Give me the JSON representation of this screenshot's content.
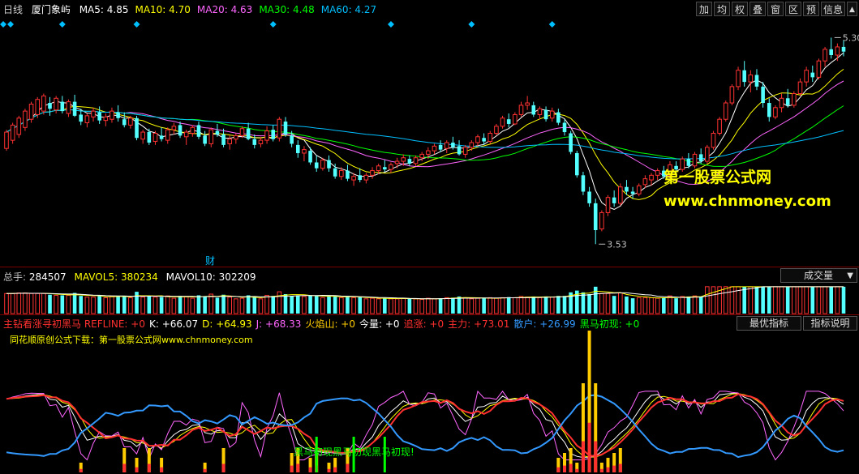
{
  "header": {
    "period": "日线",
    "stock": "厦门象屿",
    "ma": [
      {
        "label": "MA5:",
        "value": "4.85",
        "color": "#ffffff"
      },
      {
        "label": "MA10:",
        "value": "4.70",
        "color": "#ffff00"
      },
      {
        "label": "MA20:",
        "value": "4.63",
        "color": "#ff66ff"
      },
      {
        "label": "MA30:",
        "value": "4.48",
        "color": "#00ff00"
      },
      {
        "label": "MA60:",
        "value": "4.27",
        "color": "#00bfff"
      }
    ]
  },
  "toolbar": [
    "加",
    "均",
    "权",
    "叠",
    "窗",
    "区",
    "预",
    "信息"
  ],
  "toolbar_arrow": "▲",
  "price": {
    "high_label": "5.30",
    "low_label": "3.53",
    "marker": "财",
    "watermark1": "第一股票公式网",
    "watermark2": "www.chnmoney.com"
  },
  "volume": {
    "label": "总手:",
    "value": "284507",
    "mavol5_label": "MAVOL5:",
    "mavol5": "380234",
    "mavol10_label": "MAVOL10:",
    "mavol10": "302209",
    "dropdown": "成交量"
  },
  "indicator": {
    "items": [
      {
        "label": "主钻看涨寻初黑马 REFLINE:",
        "value": "+0",
        "color": "#ff3030"
      },
      {
        "label": "K:",
        "value": "+66.07",
        "color": "#ffffff"
      },
      {
        "label": "D:",
        "value": "+64.93",
        "color": "#ffff00"
      },
      {
        "label": "J:",
        "value": "+68.33",
        "color": "#ff66ff"
      },
      {
        "label": "火焰山:",
        "value": "+0",
        "color": "#ffcc00"
      },
      {
        "label": "今量:",
        "value": "+0",
        "color": "#ffffff"
      },
      {
        "label": "追涨:",
        "value": "+0",
        "color": "#ff3030"
      },
      {
        "label": "主力:",
        "value": "+73.01",
        "color": "#ff3030"
      },
      {
        "label": "散户:",
        "value": "+26.99",
        "color": "#3399ff"
      },
      {
        "label": "黑马初现:",
        "value": "+0",
        "color": "#00ff00"
      }
    ],
    "btn_best": "最优指标",
    "btn_desc": "指标说明",
    "note": "同花顺原创公式下载：第一股票公式网www.chnmoney.com",
    "signal_text": "黑马初现黑马初现黑马初现!"
  },
  "chart_data": {
    "type": "candlestick",
    "ylim": [
      3.4,
      5.4
    ],
    "ohlc": [
      [
        4.35,
        4.51,
        4.33,
        4.49
      ],
      [
        4.42,
        4.57,
        4.39,
        4.55
      ],
      [
        4.47,
        4.63,
        4.44,
        4.61
      ],
      [
        4.53,
        4.69,
        4.5,
        4.67
      ],
      [
        4.6,
        4.75,
        4.57,
        4.73
      ],
      [
        4.64,
        4.79,
        4.61,
        4.77
      ],
      [
        4.67,
        4.82,
        4.64,
        4.8
      ],
      [
        4.74,
        4.79,
        4.63,
        4.69
      ],
      [
        4.68,
        4.8,
        4.65,
        4.78
      ],
      [
        4.75,
        4.8,
        4.65,
        4.67
      ],
      [
        4.65,
        4.77,
        4.62,
        4.75
      ],
      [
        4.75,
        4.81,
        4.62,
        4.63
      ],
      [
        4.64,
        4.69,
        4.55,
        4.58
      ],
      [
        4.57,
        4.65,
        4.53,
        4.63
      ],
      [
        4.62,
        4.7,
        4.58,
        4.67
      ],
      [
        4.66,
        4.71,
        4.56,
        4.59
      ],
      [
        4.59,
        4.65,
        4.54,
        4.62
      ],
      [
        4.6,
        4.7,
        4.57,
        4.67
      ],
      [
        4.66,
        4.72,
        4.58,
        4.61
      ],
      [
        4.6,
        4.66,
        4.53,
        4.55
      ],
      [
        4.55,
        4.63,
        4.52,
        4.61
      ],
      [
        4.61,
        4.63,
        4.42,
        4.44
      ],
      [
        4.43,
        4.51,
        4.39,
        4.49
      ],
      [
        4.49,
        4.52,
        4.38,
        4.4
      ],
      [
        4.41,
        4.5,
        4.38,
        4.48
      ],
      [
        4.46,
        4.53,
        4.41,
        4.43
      ],
      [
        4.42,
        4.53,
        4.39,
        4.51
      ],
      [
        4.51,
        4.57,
        4.47,
        4.54
      ],
      [
        4.55,
        4.58,
        4.44,
        4.46
      ],
      [
        4.45,
        4.51,
        4.38,
        4.49
      ],
      [
        4.48,
        4.55,
        4.45,
        4.53
      ],
      [
        4.55,
        4.58,
        4.43,
        4.45
      ],
      [
        4.46,
        4.5,
        4.37,
        4.39
      ],
      [
        4.39,
        4.53,
        4.36,
        4.51
      ],
      [
        4.5,
        4.56,
        4.45,
        4.47
      ],
      [
        4.47,
        4.52,
        4.36,
        4.38
      ],
      [
        4.39,
        4.46,
        4.34,
        4.43
      ],
      [
        4.43,
        4.48,
        4.39,
        4.46
      ],
      [
        4.46,
        4.54,
        4.44,
        4.52
      ],
      [
        4.52,
        4.57,
        4.42,
        4.43
      ],
      [
        4.43,
        4.47,
        4.35,
        4.38
      ],
      [
        4.39,
        4.45,
        4.36,
        4.42
      ],
      [
        4.42,
        4.54,
        4.39,
        4.5
      ],
      [
        4.51,
        4.55,
        4.41,
        4.43
      ],
      [
        4.44,
        4.62,
        4.41,
        4.6
      ],
      [
        4.58,
        4.62,
        4.45,
        4.47
      ],
      [
        4.46,
        4.5,
        4.36,
        4.39
      ],
      [
        4.38,
        4.42,
        4.27,
        4.31
      ],
      [
        4.31,
        4.37,
        4.24,
        4.34
      ],
      [
        4.33,
        4.36,
        4.21,
        4.23
      ],
      [
        4.23,
        4.29,
        4.15,
        4.18
      ],
      [
        4.18,
        4.27,
        4.16,
        4.25
      ],
      [
        4.25,
        4.29,
        4.15,
        4.18
      ],
      [
        4.18,
        4.22,
        4.09,
        4.11
      ],
      [
        4.11,
        4.19,
        4.08,
        4.16
      ],
      [
        4.16,
        4.21,
        4.07,
        4.09
      ],
      [
        4.08,
        4.14,
        4.03,
        4.11
      ],
      [
        4.12,
        4.18,
        4.06,
        4.08
      ],
      [
        4.08,
        4.14,
        4.05,
        4.12
      ],
      [
        4.12,
        4.19,
        4.09,
        4.16
      ],
      [
        4.16,
        4.22,
        4.13,
        4.2
      ],
      [
        4.19,
        4.25,
        4.15,
        4.17
      ],
      [
        4.17,
        4.23,
        4.14,
        4.21
      ],
      [
        4.22,
        4.27,
        4.18,
        4.24
      ],
      [
        4.24,
        4.3,
        4.2,
        4.27
      ],
      [
        4.26,
        4.29,
        4.2,
        4.22
      ],
      [
        4.22,
        4.29,
        4.2,
        4.27
      ],
      [
        4.27,
        4.32,
        4.24,
        4.3
      ],
      [
        4.3,
        4.36,
        4.26,
        4.33
      ],
      [
        4.33,
        4.39,
        4.3,
        4.37
      ],
      [
        4.38,
        4.42,
        4.32,
        4.34
      ],
      [
        4.35,
        4.42,
        4.31,
        4.4
      ],
      [
        4.4,
        4.45,
        4.34,
        4.36
      ],
      [
        4.37,
        4.42,
        4.29,
        4.3
      ],
      [
        4.3,
        4.38,
        4.27,
        4.36
      ],
      [
        4.36,
        4.42,
        4.33,
        4.4
      ],
      [
        4.4,
        4.47,
        4.37,
        4.45
      ],
      [
        4.44,
        4.48,
        4.38,
        4.41
      ],
      [
        4.41,
        4.5,
        4.39,
        4.48
      ],
      [
        4.48,
        4.56,
        4.46,
        4.54
      ],
      [
        4.54,
        4.63,
        4.52,
        4.61
      ],
      [
        4.6,
        4.65,
        4.53,
        4.56
      ],
      [
        4.56,
        4.66,
        4.55,
        4.64
      ],
      [
        4.64,
        4.75,
        4.62,
        4.72
      ],
      [
        4.72,
        4.8,
        4.68,
        4.74
      ],
      [
        4.72,
        4.75,
        4.62,
        4.64
      ],
      [
        4.64,
        4.71,
        4.6,
        4.69
      ],
      [
        4.68,
        4.71,
        4.58,
        4.6
      ],
      [
        4.61,
        4.7,
        4.58,
        4.67
      ],
      [
        4.66,
        4.69,
        4.55,
        4.57
      ],
      [
        4.57,
        4.6,
        4.46,
        4.49
      ],
      [
        4.48,
        4.5,
        4.3,
        4.32
      ],
      [
        4.31,
        4.33,
        4.1,
        4.12
      ],
      [
        4.12,
        4.15,
        3.95,
        3.98
      ],
      [
        3.98,
        4.02,
        3.85,
        3.88
      ],
      [
        3.88,
        3.92,
        3.53,
        3.65
      ],
      [
        3.66,
        3.82,
        3.64,
        3.8
      ],
      [
        3.8,
        3.95,
        3.77,
        3.93
      ],
      [
        3.93,
        3.99,
        3.85,
        3.88
      ],
      [
        3.88,
        4.05,
        3.86,
        4.02
      ],
      [
        4.02,
        4.08,
        3.95,
        3.98
      ],
      [
        3.98,
        4.02,
        3.92,
        3.96
      ],
      [
        3.96,
        4.05,
        3.94,
        4.03
      ],
      [
        4.04,
        4.12,
        4.01,
        4.09
      ],
      [
        4.08,
        4.14,
        4.03,
        4.12
      ],
      [
        4.12,
        4.18,
        4.08,
        4.16
      ],
      [
        4.16,
        4.2,
        4.09,
        4.11
      ],
      [
        4.12,
        4.24,
        4.1,
        4.21
      ],
      [
        4.2,
        4.24,
        4.14,
        4.17
      ],
      [
        4.17,
        4.28,
        4.15,
        4.26
      ],
      [
        4.26,
        4.31,
        4.18,
        4.2
      ],
      [
        4.2,
        4.32,
        4.18,
        4.3
      ],
      [
        4.3,
        4.35,
        4.22,
        4.24
      ],
      [
        4.24,
        4.38,
        4.22,
        4.36
      ],
      [
        4.36,
        4.5,
        4.34,
        4.48
      ],
      [
        4.48,
        4.62,
        4.46,
        4.6
      ],
      [
        4.6,
        4.76,
        4.58,
        4.74
      ],
      [
        4.74,
        4.9,
        4.72,
        4.88
      ],
      [
        4.88,
        5.05,
        4.85,
        5.02
      ],
      [
        5.02,
        5.1,
        4.88,
        4.92
      ],
      [
        4.92,
        5.02,
        4.83,
        4.98
      ],
      [
        4.98,
        5.03,
        4.85,
        4.88
      ],
      [
        4.88,
        4.92,
        4.7,
        4.74
      ],
      [
        4.74,
        4.78,
        4.58,
        4.62
      ],
      [
        4.62,
        4.72,
        4.6,
        4.7
      ],
      [
        4.7,
        4.82,
        4.66,
        4.78
      ],
      [
        4.78,
        4.86,
        4.7,
        4.72
      ],
      [
        4.72,
        4.84,
        4.7,
        4.82
      ],
      [
        4.82,
        4.95,
        4.8,
        4.92
      ],
      [
        4.92,
        5.05,
        4.88,
        5.02
      ],
      [
        5.0,
        5.06,
        4.92,
        4.96
      ],
      [
        4.96,
        5.12,
        4.94,
        5.1
      ],
      [
        5.1,
        5.22,
        5.05,
        5.2
      ],
      [
        5.2,
        5.3,
        5.12,
        5.15
      ],
      [
        5.15,
        5.25,
        5.1,
        5.22
      ],
      [
        5.22,
        5.28,
        5.14,
        5.18
      ]
    ]
  }
}
